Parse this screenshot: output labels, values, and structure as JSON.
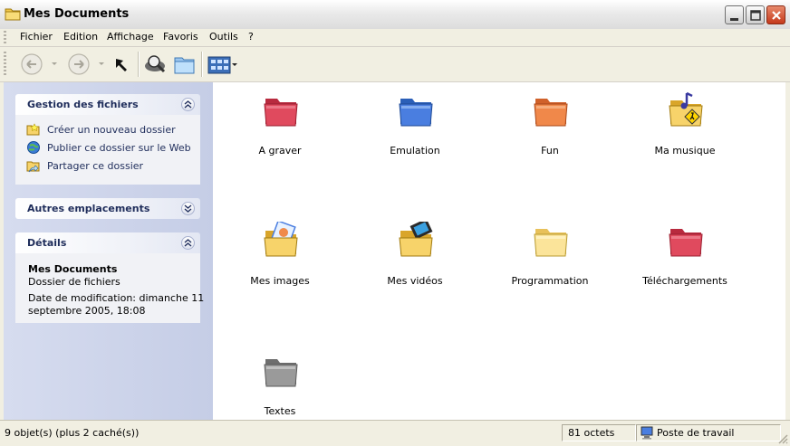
{
  "window": {
    "title": "Mes Documents"
  },
  "menu": [
    {
      "label": "Fichier"
    },
    {
      "label": "Edition"
    },
    {
      "label": "Affichage"
    },
    {
      "label": "Favoris"
    },
    {
      "label": "Outils"
    },
    {
      "label": "?"
    }
  ],
  "toolbar": {
    "buttons": [
      "back-icon",
      "forward-icon",
      "up-arrow-icon",
      "search-icon",
      "folders-icon",
      "views-icon"
    ]
  },
  "tasks": {
    "file_management": {
      "title": "Gestion des fichiers",
      "links": [
        {
          "label": "Créer un nouveau dossier",
          "icon": "new-folder-icon"
        },
        {
          "label": "Publier ce dossier sur le Web",
          "icon": "web-publish-icon"
        },
        {
          "label": "Partager ce dossier",
          "icon": "share-folder-icon"
        }
      ]
    },
    "other_places": {
      "title": "Autres emplacements"
    },
    "details": {
      "title": "Détails",
      "name": "Mes Documents",
      "type": "Dossier de fichiers",
      "modified_line1": "Date de modification: dimanche 11",
      "modified_line2": "septembre 2005, 18:08"
    }
  },
  "folders": [
    {
      "label": "A graver",
      "color": "#e04a5e",
      "icon": "folder-red-icon"
    },
    {
      "label": "Emulation",
      "color": "#4a7ee0",
      "icon": "folder-blue-icon"
    },
    {
      "label": "Fun",
      "color": "#f0884a",
      "icon": "folder-orange-icon"
    },
    {
      "label": "Ma musique",
      "color": "#f7d36a",
      "icon": "music-folder-icon"
    },
    {
      "label": "Mes images",
      "color": "#f7d36a",
      "icon": "pictures-folder-icon"
    },
    {
      "label": "Mes vidéos",
      "color": "#f7d36a",
      "icon": "videos-folder-icon"
    },
    {
      "label": "Programmation",
      "color": "#fbe49a",
      "icon": "folder-yellow-icon"
    },
    {
      "label": "Téléchargements",
      "color": "#e04a5e",
      "icon": "folder-red-icon"
    },
    {
      "label": "Textes",
      "color": "#9a9a9a",
      "icon": "folder-gray-icon"
    }
  ],
  "status": {
    "objects": "9 objet(s) (plus 2 caché(s))",
    "size": "81 octets",
    "location": "Poste de travail"
  }
}
